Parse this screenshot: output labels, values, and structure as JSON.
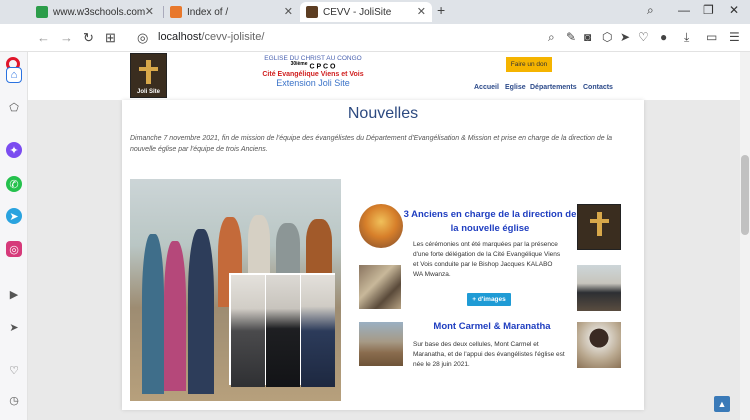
{
  "browser": {
    "tabs": [
      {
        "title": "www.w3schools.com",
        "favicon_color": "#2c9d4a"
      },
      {
        "title": "Index of /",
        "favicon_color": "#e8782c"
      },
      {
        "title": "CEVV - JoliSite",
        "favicon_color": "#5c3d22"
      }
    ],
    "active_tab": 2,
    "url_host": "localhost",
    "url_path": "/cevv-jolisite/"
  },
  "site": {
    "logo_text": "Joli Site",
    "church_line1": "EGLISE DU CHRIST AU CONGO",
    "church_line2_sup": "30ième",
    "church_line2": "C P C O",
    "church_line3": "Cité Evangélique Viens et Vois",
    "church_line4": "Extension Joli Site",
    "donate_label": "Faire un don",
    "menu": [
      "Accueil",
      "Eglise",
      "Départements",
      "Contacts"
    ]
  },
  "page": {
    "title": "Nouvelles",
    "intro": "Dimanche 7 novembre 2021, fin de mission de l'équipe des évangélistes du Département d'Evangélisation & Mission et prise en charge de la direction de la nouvelle église par l'équipe de trois Anciens.",
    "news": [
      {
        "title": "3 Anciens en charge de la direction de la nouvelle église",
        "text": "Les cérémonies ont été marquées par la présence d'une forte délégation de la Cité Evangélique Viens et Vois conduite par le Bishop Jacques KALABO WA Mwanza.",
        "button": "+ d'images"
      },
      {
        "title": "Mont Carmel & Maranatha",
        "text": "Sur base des deux cellules, Mont Carmel et Maranatha, et de l'appui des évangélistes l'église est née le 28 juin 2021."
      }
    ]
  },
  "icons": {
    "back": "arrow-left-icon",
    "forward": "arrow-right-icon",
    "reload": "reload-icon",
    "scroll_top": "chevron-up-icon"
  },
  "colors": {
    "accent_blue": "#1f3ec0",
    "donate_yellow": "#f5b400",
    "button_blue": "#1f9bd5",
    "opera_red": "#e0162b"
  }
}
